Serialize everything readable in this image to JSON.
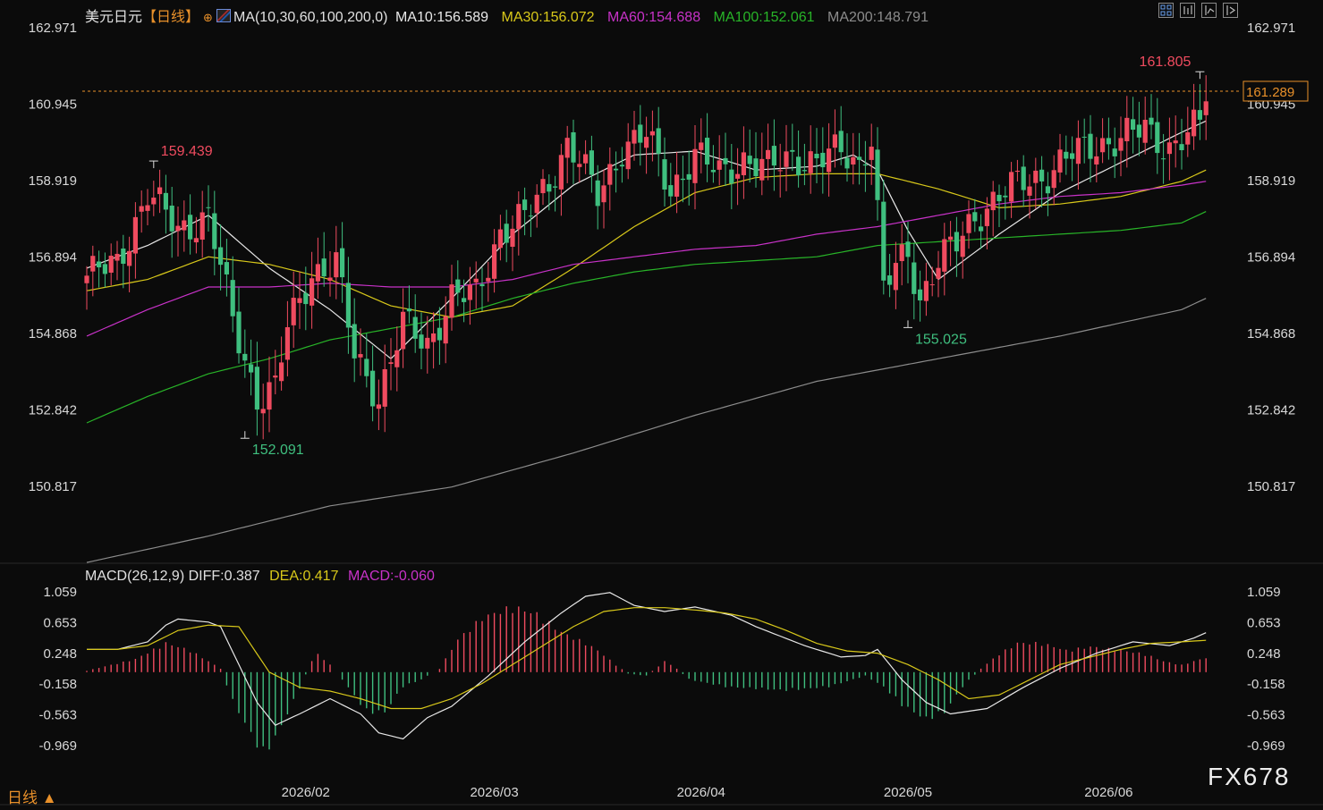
{
  "header": {
    "symbol": "美元日元",
    "period": "【日线】",
    "ma_params": "MA(10,30,60,100,200,0)",
    "ma10": "MA10:156.589",
    "ma30": "MA30:156.072",
    "ma60": "MA60:154.688",
    "ma100": "MA100:152.061",
    "ma200": "MA200:148.791"
  },
  "macd_header": {
    "params": "MACD(26,12,9)",
    "diff": "DIFF:0.387",
    "dea": "DEA:0.417",
    "macd": "MACD:-0.060"
  },
  "footer": {
    "period_tab": "日线 ▲",
    "watermark": "FX678"
  },
  "toolbar": {
    "icons": [
      "grid-layout-icon",
      "chart-single-icon",
      "chart-compare-icon",
      "chart-export-icon"
    ]
  },
  "colors": {
    "up": "#ef4b5f",
    "down": "#3fbf7f",
    "ma10": "#e8e8e8",
    "ma30": "#d8c81a",
    "ma60": "#c832c8",
    "ma100": "#28b428",
    "ma200": "#8c8c8c",
    "diff": "#e8e8e8",
    "dea": "#d8c81a",
    "accent": "#e8902a"
  },
  "chart_data": [
    {
      "type": "candlestick",
      "title": "美元日元【日线】",
      "y_ticks": [
        "162.971",
        "160.945",
        "158.919",
        "156.894",
        "154.868",
        "152.842",
        "150.817"
      ],
      "ylim": [
        150.817,
        162.971
      ],
      "x_ticks": [
        "2026/02",
        "2026/03",
        "2026/04",
        "2026/05",
        "2026/06"
      ],
      "current_price": "161.289",
      "annotations": [
        {
          "label": "159.439",
          "type": "high"
        },
        {
          "label": "152.091",
          "type": "low"
        },
        {
          "label": "155.025",
          "type": "low"
        },
        {
          "label": "161.805",
          "type": "high"
        }
      ],
      "ohlc_keypoints": [
        {
          "i": 0,
          "close": 156.4
        },
        {
          "i": 5,
          "close": 156.7
        },
        {
          "i": 10,
          "close": 158.6
        },
        {
          "i": 15,
          "close": 157.6
        },
        {
          "i": 20,
          "close": 158.0
        },
        {
          "i": 24,
          "close": 155.2
        },
        {
          "i": 28,
          "close": 153.2
        },
        {
          "i": 31,
          "close": 153.4
        },
        {
          "i": 33,
          "close": 155.0
        },
        {
          "i": 37,
          "close": 156.5
        },
        {
          "i": 41,
          "close": 156.7
        },
        {
          "i": 44,
          "close": 154.3
        },
        {
          "i": 48,
          "close": 153.2
        },
        {
          "i": 52,
          "close": 155.1
        },
        {
          "i": 56,
          "close": 154.6
        },
        {
          "i": 60,
          "close": 155.8
        },
        {
          "i": 64,
          "close": 155.9
        },
        {
          "i": 68,
          "close": 157.6
        },
        {
          "i": 72,
          "close": 157.9
        },
        {
          "i": 76,
          "close": 158.9
        },
        {
          "i": 79,
          "close": 159.9
        },
        {
          "i": 81,
          "close": 159.4
        },
        {
          "i": 84,
          "close": 158.5
        },
        {
          "i": 88,
          "close": 159.8
        },
        {
          "i": 92,
          "close": 160.1
        },
        {
          "i": 96,
          "close": 158.7
        },
        {
          "i": 100,
          "close": 159.6
        },
        {
          "i": 104,
          "close": 159.1
        },
        {
          "i": 108,
          "close": 159.5
        },
        {
          "i": 112,
          "close": 159.2
        },
        {
          "i": 116,
          "close": 159.6
        },
        {
          "i": 120,
          "close": 159.4
        },
        {
          "i": 124,
          "close": 159.7
        },
        {
          "i": 127,
          "close": 159.4
        },
        {
          "i": 129,
          "close": 160.1
        },
        {
          "i": 131,
          "close": 156.0
        },
        {
          "i": 133,
          "close": 156.6
        },
        {
          "i": 135,
          "close": 157.0
        },
        {
          "i": 137,
          "close": 155.8
        },
        {
          "i": 140,
          "close": 156.8
        },
        {
          "i": 143,
          "close": 157.2
        },
        {
          "i": 146,
          "close": 158.0
        },
        {
          "i": 150,
          "close": 158.5
        },
        {
          "i": 154,
          "close": 158.9
        },
        {
          "i": 158,
          "close": 159.1
        },
        {
          "i": 162,
          "close": 159.6
        },
        {
          "i": 166,
          "close": 159.9
        },
        {
          "i": 170,
          "close": 160.0
        },
        {
          "i": 174,
          "close": 160.3
        },
        {
          "i": 178,
          "close": 159.8
        },
        {
          "i": 181,
          "close": 160.1
        },
        {
          "i": 183,
          "close": 160.4
        },
        {
          "i": 184,
          "close": 161.3
        }
      ],
      "series": [
        {
          "name": "MA10",
          "x": [
            0,
            10,
            20,
            30,
            40,
            50,
            60,
            70,
            80,
            90,
            100,
            110,
            120,
            126,
            130,
            135,
            140,
            150,
            160,
            170,
            180,
            184
          ],
          "values": [
            156.6,
            157.2,
            158.0,
            156.6,
            155.5,
            154.2,
            155.8,
            157.5,
            158.8,
            159.6,
            159.7,
            159.2,
            159.3,
            159.6,
            159.2,
            157.6,
            156.3,
            157.5,
            158.6,
            159.4,
            160.2,
            160.5
          ]
        },
        {
          "name": "MA30",
          "x": [
            0,
            10,
            20,
            30,
            40,
            50,
            60,
            70,
            80,
            90,
            100,
            110,
            120,
            130,
            140,
            150,
            160,
            170,
            180,
            184
          ],
          "values": [
            156.0,
            156.3,
            156.9,
            156.7,
            156.3,
            155.6,
            155.3,
            155.6,
            156.6,
            157.7,
            158.6,
            159.0,
            159.1,
            159.1,
            158.7,
            158.2,
            158.3,
            158.5,
            158.9,
            159.2
          ]
        },
        {
          "name": "MA60",
          "x": [
            0,
            10,
            20,
            30,
            40,
            50,
            60,
            70,
            80,
            90,
            100,
            110,
            120,
            130,
            140,
            150,
            160,
            170,
            180,
            184
          ],
          "values": [
            154.8,
            155.5,
            156.1,
            156.1,
            156.2,
            156.1,
            156.1,
            156.3,
            156.7,
            156.9,
            157.1,
            157.2,
            157.5,
            157.7,
            158.0,
            158.3,
            158.5,
            158.6,
            158.8,
            158.9
          ]
        },
        {
          "name": "MA100",
          "x": [
            0,
            10,
            20,
            30,
            40,
            50,
            60,
            70,
            80,
            90,
            100,
            110,
            120,
            130,
            140,
            150,
            160,
            170,
            180,
            184
          ],
          "values": [
            152.5,
            153.2,
            153.8,
            154.2,
            154.7,
            155.0,
            155.3,
            155.8,
            156.2,
            156.5,
            156.7,
            156.8,
            156.9,
            157.2,
            157.3,
            157.4,
            157.5,
            157.6,
            157.8,
            158.1
          ]
        },
        {
          "name": "MA200",
          "x": [
            0,
            20,
            40,
            60,
            80,
            100,
            120,
            140,
            160,
            180,
            184
          ],
          "values": [
            148.8,
            149.5,
            150.3,
            150.8,
            151.7,
            152.7,
            153.6,
            154.2,
            154.8,
            155.5,
            155.8
          ]
        }
      ]
    },
    {
      "type": "macd",
      "title": "MACD(26,12,9)",
      "y_ticks": [
        "1.059",
        "0.653",
        "0.248",
        "-0.158",
        "-0.563",
        "-0.969"
      ],
      "ylim": [
        -0.969,
        1.059
      ],
      "diff": {
        "x": [
          0,
          5,
          10,
          13,
          15,
          20,
          22,
          25,
          28,
          31,
          35,
          40,
          45,
          48,
          52,
          56,
          60,
          66,
          72,
          78,
          82,
          86,
          90,
          95,
          100,
          106,
          110,
          118,
          124,
          128,
          130,
          134,
          138,
          142,
          148,
          154,
          160,
          166,
          172,
          178,
          182,
          184
        ],
        "values": [
          0.3,
          0.3,
          0.4,
          0.62,
          0.7,
          0.66,
          0.6,
          0.1,
          -0.4,
          -0.7,
          -0.55,
          -0.35,
          -0.55,
          -0.8,
          -0.88,
          -0.6,
          -0.45,
          -0.05,
          0.4,
          0.78,
          1.0,
          1.05,
          0.88,
          0.8,
          0.86,
          0.75,
          0.6,
          0.35,
          0.2,
          0.22,
          0.3,
          -0.1,
          -0.4,
          -0.55,
          -0.48,
          -0.2,
          0.05,
          0.25,
          0.4,
          0.35,
          0.45,
          0.52
        ]
      },
      "dea": {
        "x": [
          0,
          5,
          10,
          15,
          20,
          25,
          30,
          35,
          40,
          45,
          50,
          55,
          60,
          65,
          70,
          75,
          80,
          85,
          90,
          95,
          100,
          105,
          110,
          115,
          120,
          125,
          130,
          135,
          140,
          145,
          150,
          155,
          160,
          165,
          170,
          175,
          180,
          184
        ],
        "values": [
          0.3,
          0.3,
          0.35,
          0.55,
          0.62,
          0.6,
          0.0,
          -0.2,
          -0.25,
          -0.35,
          -0.48,
          -0.48,
          -0.35,
          -0.15,
          0.1,
          0.35,
          0.6,
          0.8,
          0.85,
          0.85,
          0.82,
          0.78,
          0.7,
          0.55,
          0.38,
          0.28,
          0.25,
          0.1,
          -0.1,
          -0.35,
          -0.3,
          -0.1,
          0.1,
          0.2,
          0.3,
          0.38,
          0.4,
          0.42
        ]
      },
      "histogram_keypoints": [
        {
          "i": 0,
          "v": 0.02
        },
        {
          "i": 8,
          "v": 0.18
        },
        {
          "i": 13,
          "v": 0.4
        },
        {
          "i": 17,
          "v": 0.3
        },
        {
          "i": 22,
          "v": 0.05
        },
        {
          "i": 24,
          "v": -0.4
        },
        {
          "i": 27,
          "v": -0.85
        },
        {
          "i": 29,
          "v": -1.15
        },
        {
          "i": 31,
          "v": -0.9
        },
        {
          "i": 34,
          "v": -0.4
        },
        {
          "i": 37,
          "v": 0.15
        },
        {
          "i": 38,
          "v": 0.25
        },
        {
          "i": 40,
          "v": 0.1
        },
        {
          "i": 42,
          "v": -0.1
        },
        {
          "i": 46,
          "v": -0.55
        },
        {
          "i": 49,
          "v": -0.55
        },
        {
          "i": 52,
          "v": -0.2
        },
        {
          "i": 55,
          "v": -0.1
        },
        {
          "i": 58,
          "v": 0.05
        },
        {
          "i": 61,
          "v": 0.45
        },
        {
          "i": 65,
          "v": 0.75
        },
        {
          "i": 70,
          "v": 0.9
        },
        {
          "i": 74,
          "v": 0.8
        },
        {
          "i": 78,
          "v": 0.55
        },
        {
          "i": 82,
          "v": 0.4
        },
        {
          "i": 84,
          "v": 0.3
        },
        {
          "i": 87,
          "v": 0.1
        },
        {
          "i": 89,
          "v": -0.02
        },
        {
          "i": 92,
          "v": -0.05
        },
        {
          "i": 95,
          "v": 0.15
        },
        {
          "i": 97,
          "v": 0.05
        },
        {
          "i": 99,
          "v": -0.1
        },
        {
          "i": 105,
          "v": -0.2
        },
        {
          "i": 115,
          "v": -0.25
        },
        {
          "i": 122,
          "v": -0.2
        },
        {
          "i": 126,
          "v": -0.1
        },
        {
          "i": 128,
          "v": -0.05
        },
        {
          "i": 131,
          "v": -0.2
        },
        {
          "i": 134,
          "v": -0.45
        },
        {
          "i": 138,
          "v": -0.65
        },
        {
          "i": 141,
          "v": -0.55
        },
        {
          "i": 144,
          "v": -0.2
        },
        {
          "i": 147,
          "v": 0.05
        },
        {
          "i": 150,
          "v": 0.25
        },
        {
          "i": 153,
          "v": 0.4
        },
        {
          "i": 157,
          "v": 0.4
        },
        {
          "i": 161,
          "v": 0.3
        },
        {
          "i": 165,
          "v": 0.35
        },
        {
          "i": 170,
          "v": 0.3
        },
        {
          "i": 174,
          "v": 0.25
        },
        {
          "i": 177,
          "v": 0.15
        },
        {
          "i": 180,
          "v": 0.1
        },
        {
          "i": 184,
          "v": 0.2
        }
      ]
    }
  ]
}
